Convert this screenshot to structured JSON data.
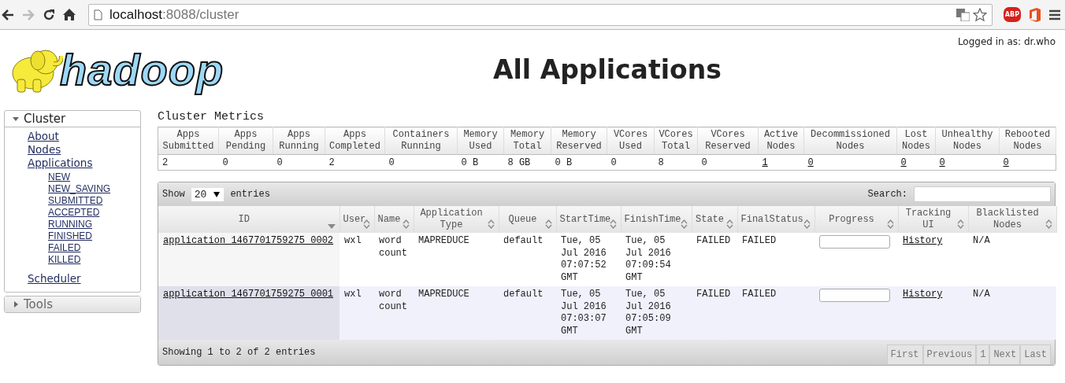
{
  "browser": {
    "url_host": "localhost",
    "url_path": ":8088/cluster",
    "adblock_label": "ABP"
  },
  "header": {
    "logo_text": "hadoop",
    "title": "All Applications",
    "logged_in": "Logged in as: dr.who"
  },
  "sidebar": [
    {
      "label": "Cluster",
      "expanded": true,
      "items": [
        {
          "label": "About"
        },
        {
          "label": "Nodes"
        },
        {
          "label": "Applications",
          "children": [
            {
              "label": "NEW"
            },
            {
              "label": "NEW_SAVING"
            },
            {
              "label": "SUBMITTED"
            },
            {
              "label": "ACCEPTED"
            },
            {
              "label": "RUNNING"
            },
            {
              "label": "FINISHED"
            },
            {
              "label": "FAILED"
            },
            {
              "label": "KILLED"
            }
          ]
        },
        {
          "label": "Scheduler"
        }
      ]
    },
    {
      "label": "Tools",
      "expanded": false
    }
  ],
  "metrics": {
    "title": "Cluster Metrics",
    "columns": [
      "Apps Submitted",
      "Apps Pending",
      "Apps Running",
      "Apps Completed",
      "Containers Running",
      "Memory Used",
      "Memory Total",
      "Memory Reserved",
      "VCores Used",
      "VCores Total",
      "VCores Reserved",
      "Active Nodes",
      "Decommissioned Nodes",
      "Lost Nodes",
      "Unhealthy Nodes",
      "Rebooted Nodes"
    ],
    "values": [
      {
        "text": "2",
        "link": false
      },
      {
        "text": "0",
        "link": false
      },
      {
        "text": "0",
        "link": false
      },
      {
        "text": "2",
        "link": false
      },
      {
        "text": "0",
        "link": false
      },
      {
        "text": "0 B",
        "link": false
      },
      {
        "text": "8 GB",
        "link": false
      },
      {
        "text": "0 B",
        "link": false
      },
      {
        "text": "0",
        "link": false
      },
      {
        "text": "8",
        "link": false
      },
      {
        "text": "0",
        "link": false
      },
      {
        "text": "1",
        "link": true
      },
      {
        "text": "0",
        "link": true
      },
      {
        "text": "0",
        "link": true
      },
      {
        "text": "0",
        "link": true
      },
      {
        "text": "0",
        "link": true
      }
    ]
  },
  "apps": {
    "show_label": "Show",
    "page_size": "20",
    "entries_label": "entries",
    "search_label": "Search:",
    "columns": [
      {
        "label": "ID",
        "sorted": true
      },
      {
        "label": "User",
        "sorted": false
      },
      {
        "label": "Name",
        "sorted": false
      },
      {
        "label": "Application Type",
        "sorted": false
      },
      {
        "label": "Queue",
        "sorted": false
      },
      {
        "label": "StartTime",
        "sorted": false
      },
      {
        "label": "FinishTime",
        "sorted": false
      },
      {
        "label": "State",
        "sorted": false
      },
      {
        "label": "FinalStatus",
        "sorted": false
      },
      {
        "label": "Progress",
        "sorted": false
      },
      {
        "label": "Tracking UI",
        "sorted": false
      },
      {
        "label": "Blacklisted Nodes",
        "sorted": false
      }
    ],
    "rows": [
      {
        "id": "application_1467701759275_0002",
        "user": "wxl",
        "name": "word count",
        "type": "MAPREDUCE",
        "queue": "default",
        "start": "Tue, 05 Jul 2016 07:07:52 GMT",
        "finish": "Tue, 05 Jul 2016 07:09:54 GMT",
        "state": "FAILED",
        "final_status": "FAILED",
        "level": 0,
        "tracking": "History",
        "blacklisted": "N/A"
      },
      {
        "id": "application_1467701759275_0001",
        "user": "wxl",
        "name": "word count",
        "type": "MAPREDUCE",
        "queue": "default",
        "start": "Tue, 05 Jul 2016 07:03:07 GMT",
        "finish": "Tue, 05 Jul 2016 07:05:09 GMT",
        "state": "FAILED",
        "final_status": "FAILED",
        "level": 0,
        "tracking": "History",
        "blacklisted": "N/A"
      }
    ],
    "info": "Showing 1 to 2 of 2 entries",
    "pager": [
      {
        "label": "First",
        "disabled": true
      },
      {
        "label": "Previous",
        "disabled": true
      },
      {
        "label": "1",
        "disabled": true
      },
      {
        "label": "Next",
        "disabled": true
      },
      {
        "label": "Last",
        "disabled": true
      }
    ]
  }
}
